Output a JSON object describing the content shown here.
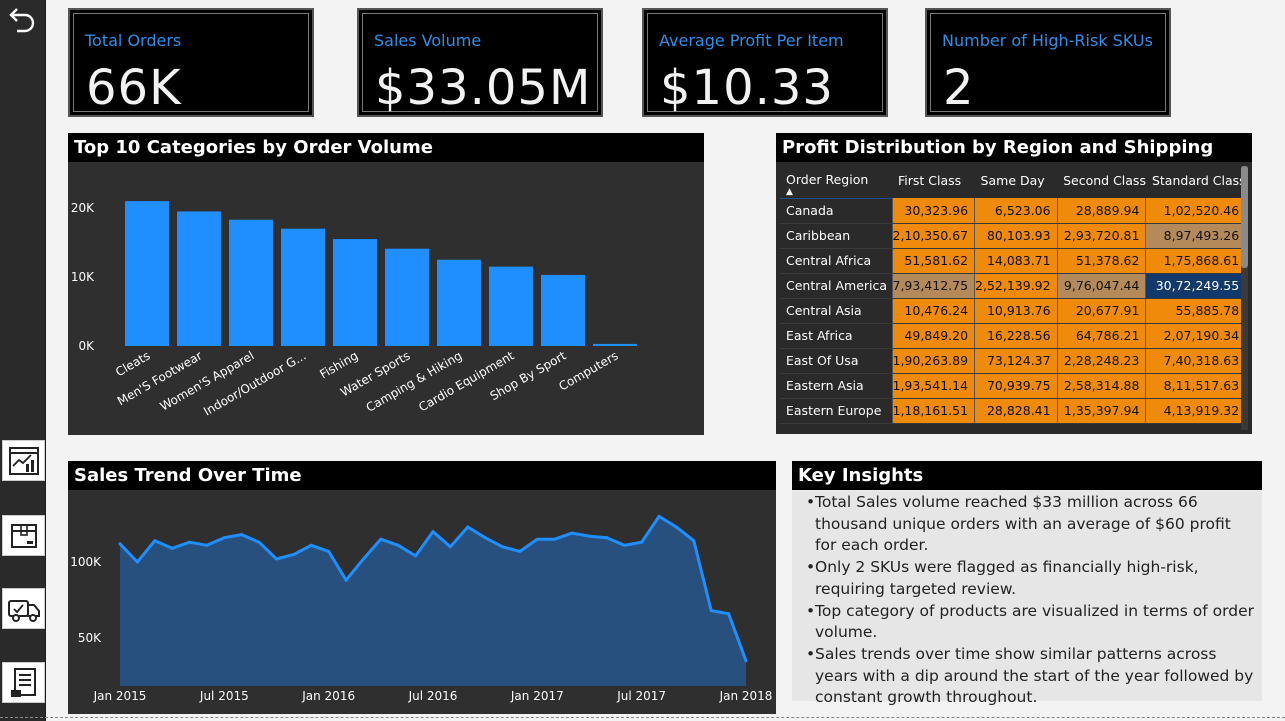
{
  "kpis": [
    {
      "label": "Total Orders",
      "value": "66K"
    },
    {
      "label": "Sales Volume",
      "value": "$33.05M"
    },
    {
      "label": "Average Profit Per Item",
      "value": "$10.33"
    },
    {
      "label": "Number of High-Risk SKUs",
      "value": "2"
    }
  ],
  "sidebar": {
    "back_icon": "undo-arrow-icon",
    "items": [
      "sales-report-icon",
      "package-icon",
      "delivery-truck-icon",
      "document-list-icon"
    ]
  },
  "bar_panel": {
    "title": "Top 10 Categories by Order Volume"
  },
  "matrix_panel": {
    "title": "Profit Distribution by Region and Shipping Mode",
    "columns": [
      "Order Region",
      "First Class",
      "Same Day",
      "Second Class",
      "Standard Class"
    ],
    "rows": [
      {
        "region": "Canada",
        "values": [
          "30,323.96",
          "6,523.06",
          "28,889.94",
          "1,02,520.46"
        ],
        "shade": [
          0,
          0,
          0,
          0
        ]
      },
      {
        "region": "Caribbean",
        "values": [
          "2,10,350.67",
          "80,103.93",
          "2,93,720.81",
          "8,97,493.26"
        ],
        "shade": [
          0,
          0,
          0,
          1
        ]
      },
      {
        "region": "Central Africa",
        "values": [
          "51,581.62",
          "14,083.71",
          "51,378.62",
          "1,75,868.61"
        ],
        "shade": [
          0,
          0,
          0,
          0
        ]
      },
      {
        "region": "Central America",
        "values": [
          "7,93,412.75",
          "2,52,139.92",
          "9,76,047.44",
          "30,72,249.55"
        ],
        "shade": [
          1,
          0,
          1,
          2
        ]
      },
      {
        "region": "Central Asia",
        "values": [
          "10,476.24",
          "10,913.76",
          "20,677.91",
          "55,885.78"
        ],
        "shade": [
          0,
          0,
          0,
          0
        ]
      },
      {
        "region": "East Africa",
        "values": [
          "49,849.20",
          "16,228.56",
          "64,786.21",
          "2,07,190.34"
        ],
        "shade": [
          0,
          0,
          0,
          0
        ]
      },
      {
        "region": "East Of Usa",
        "values": [
          "1,90,263.89",
          "73,124.37",
          "2,28,248.23",
          "7,40,318.63"
        ],
        "shade": [
          0,
          0,
          0,
          0
        ]
      },
      {
        "region": "Eastern Asia",
        "values": [
          "1,93,541.14",
          "70,939.75",
          "2,58,314.88",
          "8,11,517.63"
        ],
        "shade": [
          0,
          0,
          0,
          0
        ]
      },
      {
        "region": "Eastern Europe",
        "values": [
          "1,18,161.51",
          "28,828.41",
          "1,35,397.94",
          "4,13,919.32"
        ],
        "shade": [
          0,
          0,
          0,
          0
        ]
      }
    ],
    "colors": {
      "base": "#f08a0b",
      "mid": "#b58a5a",
      "high": "#12396b"
    }
  },
  "line_panel": {
    "title": "Sales Trend Over Time"
  },
  "insights": {
    "title": "Key Insights",
    "items": [
      "Total Sales volume reached $33 million across 66 thousand unique orders with an average of $60 profit for each order.",
      "Only 2 SKUs were flagged as financially high-risk, requiring targeted review.",
      "Top category of products are visualized in terms of order volume.",
      "Sales trends over time show similar patterns across years with a dip around the start of the year followed by constant growth throughout."
    ]
  },
  "chart_data": [
    {
      "type": "bar",
      "title": "Top 10 Categories by Order Volume",
      "categories": [
        "Cleats",
        "Men'S Footwear",
        "Women'S Apparel",
        "Indoor/Outdoor G...",
        "Fishing",
        "Water Sports",
        "Camping & Hiking",
        "Cardio Equipment",
        "Shop By Sport",
        "Computers"
      ],
      "values": [
        21000,
        19500,
        18300,
        17000,
        15500,
        14100,
        12500,
        11500,
        10300,
        300
      ],
      "ylim": [
        0,
        20000
      ],
      "yticks": [
        "0K",
        "10K",
        "20K"
      ],
      "color": "#1f8fff"
    },
    {
      "type": "area",
      "title": "Sales Trend Over Time",
      "x": [
        "2015-01",
        "2015-02",
        "2015-03",
        "2015-04",
        "2015-05",
        "2015-06",
        "2015-07",
        "2015-08",
        "2015-09",
        "2015-10",
        "2015-11",
        "2015-12",
        "2016-01",
        "2016-02",
        "2016-03",
        "2016-04",
        "2016-05",
        "2016-06",
        "2016-07",
        "2016-08",
        "2016-09",
        "2016-10",
        "2016-11",
        "2016-12",
        "2017-01",
        "2017-02",
        "2017-03",
        "2017-04",
        "2017-05",
        "2017-06",
        "2017-07",
        "2017-08",
        "2017-09",
        "2017-10",
        "2017-11",
        "2017-12",
        "2018-01"
      ],
      "values": [
        112000,
        100000,
        114000,
        109000,
        113000,
        111000,
        116000,
        118000,
        113000,
        102000,
        105000,
        111000,
        107000,
        88000,
        102000,
        115000,
        111000,
        104000,
        120000,
        110000,
        123000,
        116000,
        110000,
        107000,
        115000,
        115000,
        119000,
        117000,
        116000,
        111000,
        113000,
        130000,
        123000,
        114000,
        68000,
        66000,
        35000
      ],
      "xticks": [
        "Jan 2015",
        "Jul 2015",
        "Jan 2016",
        "Jul 2016",
        "Jan 2017",
        "Jul 2017",
        "Jan 2018"
      ],
      "yticks": [
        "50K",
        "100K"
      ],
      "color": "#1f8fff",
      "fill": "#27507f"
    }
  ]
}
